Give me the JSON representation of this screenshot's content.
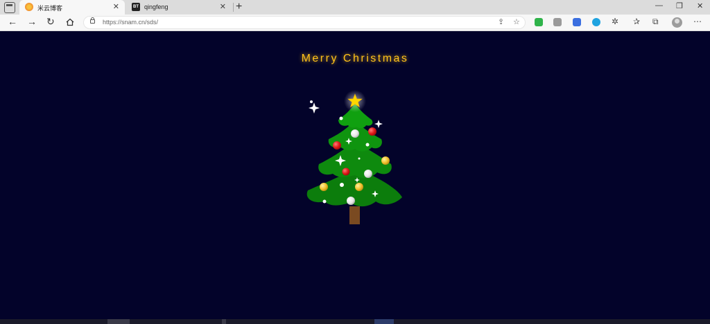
{
  "browser": {
    "tabs": [
      {
        "title": "米云博客",
        "active": true,
        "favicon": "sun-favicon-icon"
      },
      {
        "title": "qingfeng",
        "active": false,
        "favicon": "bt-favicon-icon",
        "favicon_text": "BT"
      }
    ],
    "address": {
      "url": "https://snam.cn/sds/"
    }
  },
  "page": {
    "heading": "Merry Christmas",
    "colors": {
      "background": "#03032a",
      "heading": "#ffc21a",
      "tree_green": "#0c7d0c",
      "trunk": "#7a4a21",
      "star": "#ffd700",
      "ornament_red": "#e01818",
      "ornament_gold": "#f2c12e",
      "ornament_silver": "#e6e6e6"
    }
  }
}
